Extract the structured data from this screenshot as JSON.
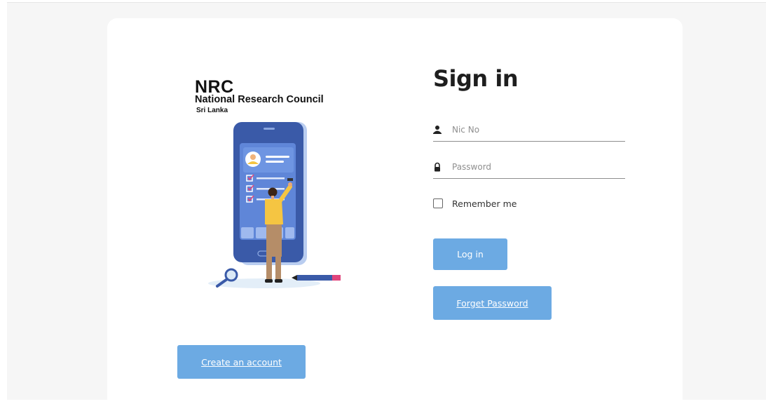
{
  "logo": {
    "abbr": "NRC",
    "name": "National Research Council",
    "country": "Sri Lanka"
  },
  "form": {
    "title": "Sign in",
    "nic_placeholder": "Nic No",
    "nic_value": "",
    "password_placeholder": "Password",
    "password_value": "",
    "remember_label": "Remember me",
    "remember_checked": false,
    "login_label": "Log in",
    "forgot_label": "Forget Password"
  },
  "create_account_label": "Create an account",
  "icons": {
    "nic": "user-icon",
    "password": "lock-icon"
  },
  "colors": {
    "button": "#6caae3",
    "page_bg": "#f6f6f6",
    "card_bg": "#ffffff"
  }
}
